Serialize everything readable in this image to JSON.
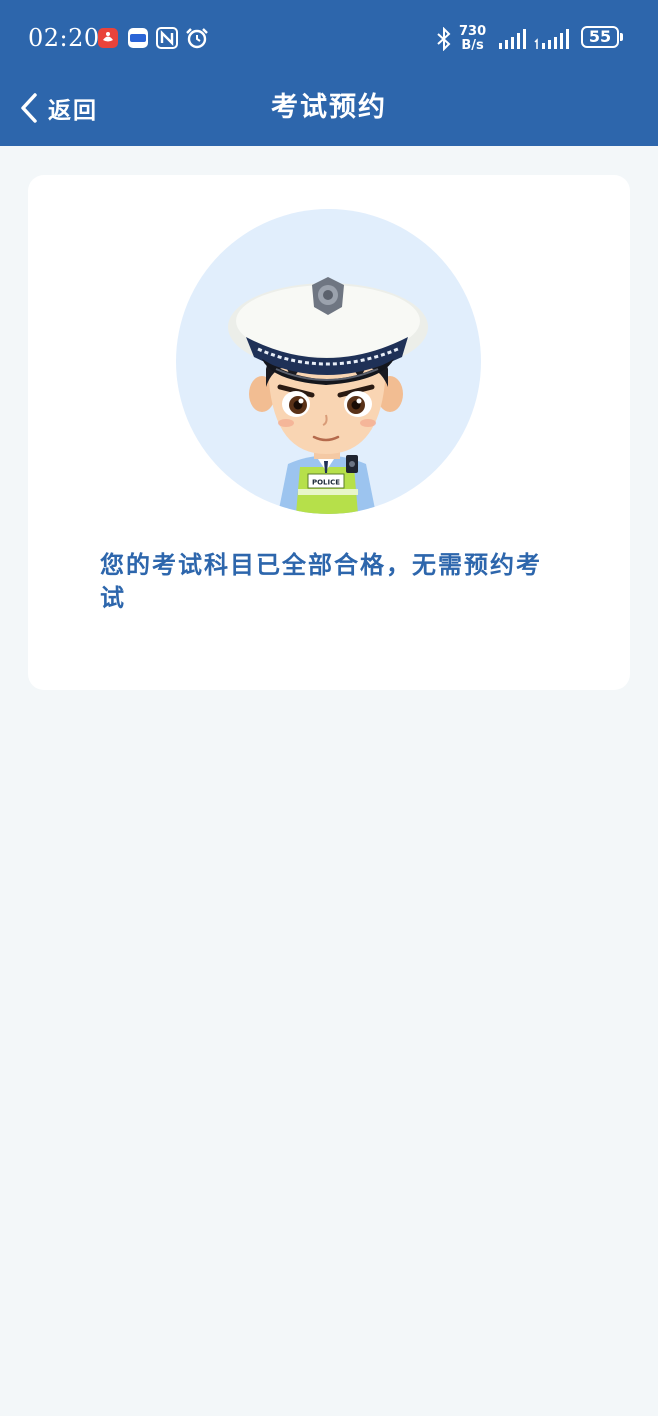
{
  "status_bar": {
    "time": "02:20",
    "net_speed_value": "730",
    "net_speed_unit": "B/s",
    "battery": "55",
    "icons": [
      "weibo-notification-icon",
      "app-notification-icon",
      "nfc-icon",
      "alarm-icon",
      "bluetooth-icon",
      "signal-icon",
      "signal-icon"
    ]
  },
  "nav": {
    "back_label": "返回",
    "title": "考试预约"
  },
  "card": {
    "illustration": "police-officer-cartoon",
    "badge_text": "POLICE",
    "message": "您的考试科目已全部合格，无需预约考试"
  },
  "colors": {
    "brand": "#2d66ac",
    "background": "#f3f7f9",
    "card": "#ffffff",
    "avatar_bg": "#e1eefc"
  }
}
